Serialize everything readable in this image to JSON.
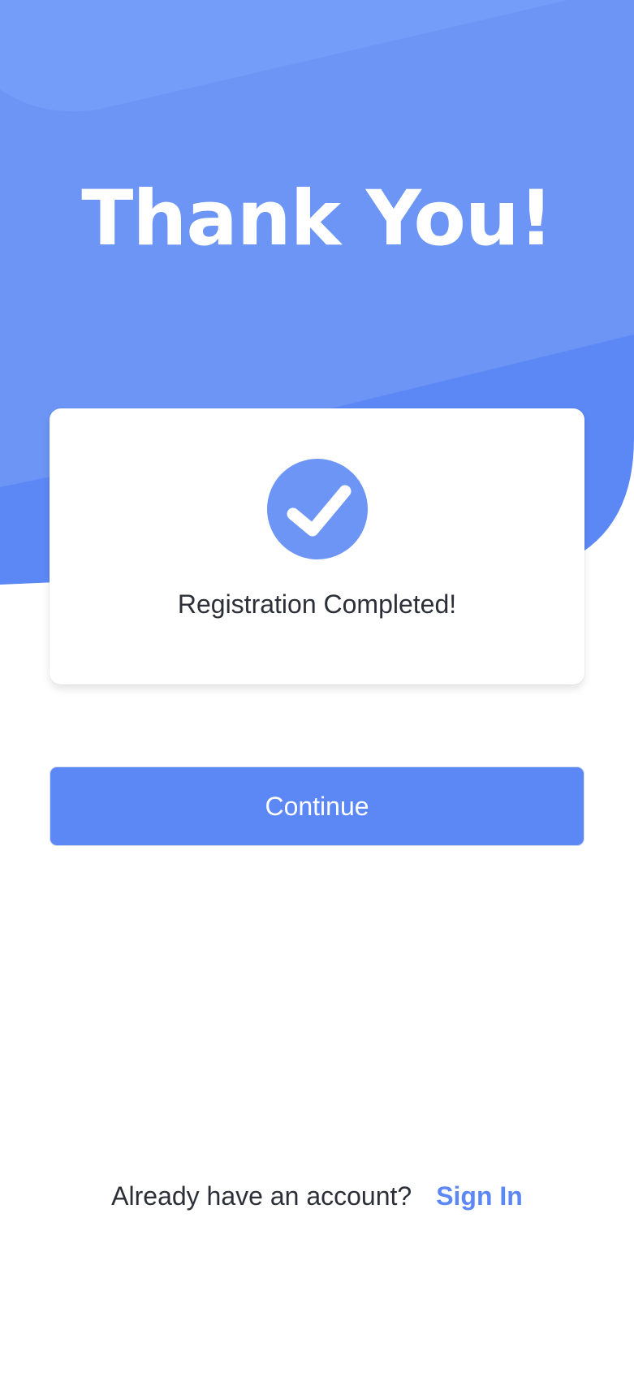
{
  "header": {
    "title": "Thank You!"
  },
  "status_card": {
    "icon": "checkmark-circle-icon",
    "message": "Registration Completed!"
  },
  "actions": {
    "continue_label": "Continue"
  },
  "footer": {
    "prompt": "Already have an account?",
    "signin_label": "Sign In"
  },
  "colors": {
    "primary": "#5c88f6",
    "header_light": "#6c95f5",
    "text": "#2c2f38",
    "background": "#ffffff"
  }
}
